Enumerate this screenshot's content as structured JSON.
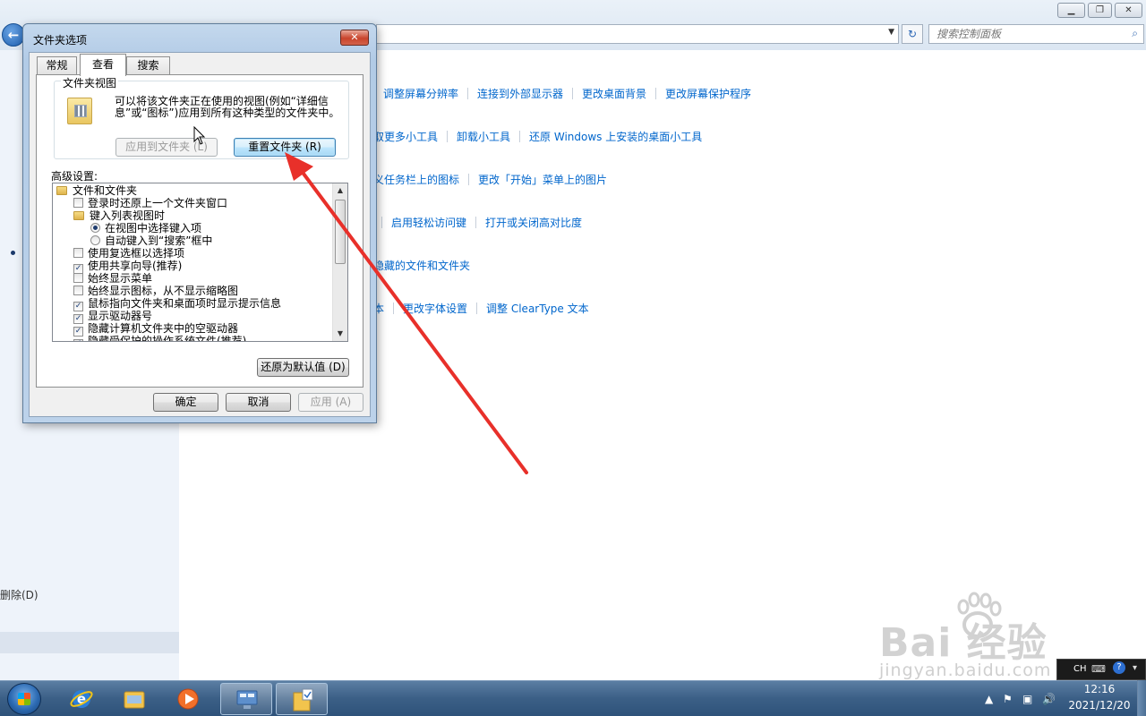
{
  "control_panel": {
    "search_placeholder": "搜索控制面板",
    "left_delete_text": "删除(D)",
    "link_rows": [
      [
        "调整屏幕分辨率",
        "连接到外部显示器",
        "更改桌面背景",
        "更改屏幕保护程序"
      ],
      [
        "取更多小工具",
        "卸载小工具",
        "还原 Windows 上安装的桌面小工具"
      ],
      [
        "义任务栏上的图标",
        "更改「开始」菜单上的图片"
      ],
      [
        "启用轻松访问键",
        "打开或关闭高对比度"
      ],
      [
        "隐藏的文件和文件夹"
      ],
      [
        "本",
        "更改字体设置",
        "调整 ClearType 文本"
      ]
    ]
  },
  "dialog": {
    "title": "文件夹选项",
    "close_glyph": "✕",
    "tabs": [
      "常规",
      "查看",
      "搜索"
    ],
    "active_tab": "查看",
    "folder_views": {
      "legend": "文件夹视图",
      "description": "可以将该文件夹正在使用的视图(例如“详细信息”或“图标”)应用到所有这种类型的文件夹中。",
      "apply_button": "应用到文件夹 (L)",
      "reset_button": "重置文件夹 (R)"
    },
    "advanced_label": "高级设置:",
    "tree": [
      {
        "kind": "folder",
        "label": "文件和文件夹",
        "indent": 0
      },
      {
        "kind": "checkbox",
        "label": "登录时还原上一个文件夹窗口",
        "checked": false,
        "indent": 1
      },
      {
        "kind": "folder",
        "label": "键入列表视图时",
        "indent": 1
      },
      {
        "kind": "radio",
        "label": "在视图中选择键入项",
        "checked": true,
        "indent": 2
      },
      {
        "kind": "radio",
        "label": "自动键入到“搜索”框中",
        "checked": false,
        "indent": 2
      },
      {
        "kind": "checkbox",
        "label": "使用复选框以选择项",
        "checked": false,
        "indent": 1
      },
      {
        "kind": "checkbox",
        "label": "使用共享向导(推荐)",
        "checked": true,
        "indent": 1
      },
      {
        "kind": "checkbox",
        "label": "始终显示菜单",
        "checked": false,
        "indent": 1
      },
      {
        "kind": "checkbox",
        "label": "始终显示图标，从不显示缩略图",
        "checked": false,
        "indent": 1
      },
      {
        "kind": "checkbox",
        "label": "鼠标指向文件夹和桌面项时显示提示信息",
        "checked": true,
        "indent": 1
      },
      {
        "kind": "checkbox",
        "label": "显示驱动器号",
        "checked": true,
        "indent": 1
      },
      {
        "kind": "checkbox",
        "label": "隐藏计算机文件夹中的空驱动器",
        "checked": true,
        "indent": 1
      },
      {
        "kind": "checkbox",
        "label": "隐藏受保护的操作系统文件(推荐)",
        "checked": true,
        "indent": 1
      }
    ],
    "restore_defaults_button": "还原为默认值 (D)",
    "ok_button": "确定",
    "cancel_button": "取消",
    "apply_button": "应用 (A)"
  },
  "watermark": {
    "brand": "Bai 经验",
    "url": "jingyan.baidu.com"
  },
  "taskbar": {
    "apps": [
      "internet-explorer",
      "windows-explorer",
      "windows-media-player",
      "control-panel",
      "folder-options"
    ],
    "language": "CH",
    "time": "12:16",
    "date": "2021/12/20"
  },
  "colors": {
    "link": "#0066cc",
    "annotation_arrow": "#e8302a",
    "taskbar": "#3b5f86"
  }
}
